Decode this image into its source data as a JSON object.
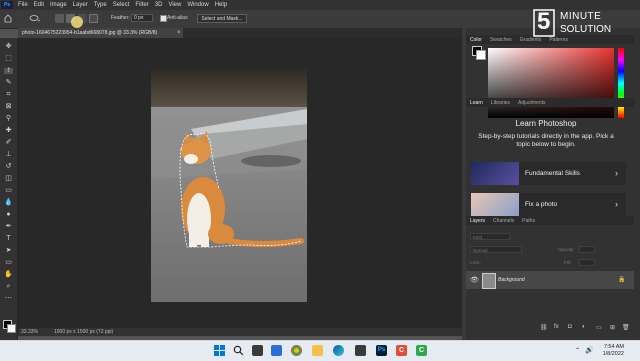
{
  "menubar": {
    "logo": "Ps",
    "items": [
      "File",
      "Edit",
      "Image",
      "Layer",
      "Type",
      "Select",
      "Filter",
      "3D",
      "View",
      "Window",
      "Help"
    ]
  },
  "options": {
    "feather_label": "Feather:",
    "feather_value": "0 px",
    "antialias_label": "Anti-alias",
    "select_mask_label": "Select and Mask..."
  },
  "document": {
    "tab_title": "photo-1604675223954-b1aabd668078.jpg @ 33.3% (RGB/8)",
    "zoom": "33.33%",
    "dimensions": "1000 px x 1500 px (72 ppi)"
  },
  "panels": {
    "color_tabs": [
      "Color",
      "Swatches",
      "Gradients",
      "Patterns"
    ],
    "learn_tabs": [
      "Learn",
      "Libraries",
      "Adjustments"
    ],
    "learn_title": "Learn Photoshop",
    "learn_desc": "Step-by-step tutorials directly in the app. Pick a topic below to begin.",
    "tutorials": [
      {
        "label": "Fundamental Skills"
      },
      {
        "label": "Fix a photo"
      }
    ],
    "layers_tabs": [
      "Layers",
      "Channels",
      "Paths"
    ],
    "layers_kind": "Kind",
    "blend_mode": "Normal",
    "opacity_label": "Opacity:",
    "fill_label": "Fill:",
    "lock_label": "Lock:",
    "layer_name": "Background"
  },
  "watermark": {
    "number": "5",
    "line1": "MINUTE",
    "line2": "SOLUTION"
  },
  "taskbar": {
    "time": "7:54 AM",
    "date": "1/8/2022"
  },
  "colors": {
    "accent": "#31a8ff",
    "color_picker_hue": "#e8322f"
  }
}
